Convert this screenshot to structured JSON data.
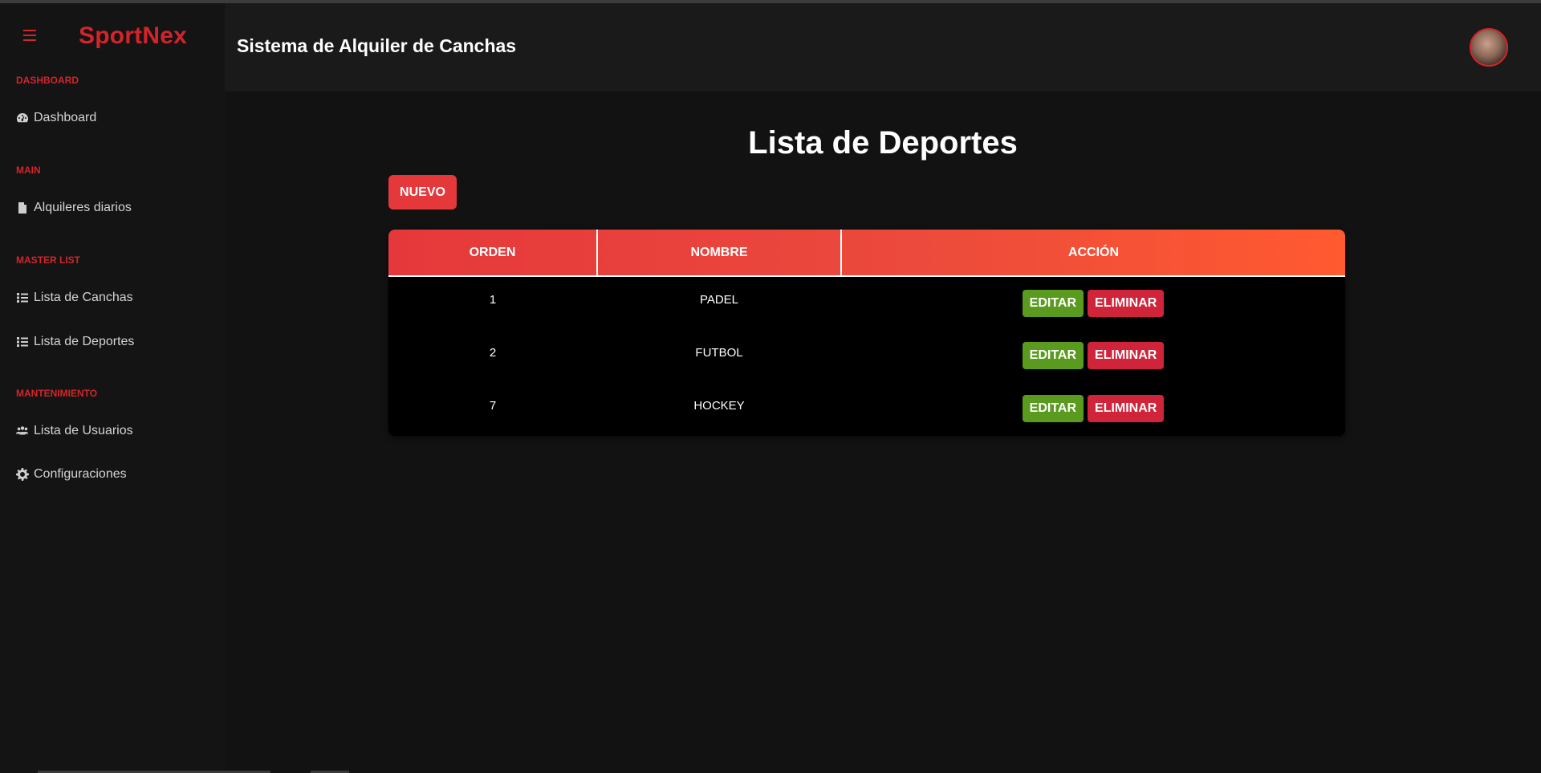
{
  "app": {
    "brand": "SportNex",
    "header_title": "Sistema de Alquiler de Canchas"
  },
  "sidebar": {
    "sections": [
      {
        "title": "DASHBOARD",
        "items": [
          {
            "label": "Dashboard",
            "icon": "gauge-icon"
          }
        ]
      },
      {
        "title": "MAIN",
        "items": [
          {
            "label": "Alquileres diarios",
            "icon": "file-icon"
          }
        ]
      },
      {
        "title": "MASTER LIST",
        "items": [
          {
            "label": "Lista de Canchas",
            "icon": "list-icon"
          },
          {
            "label": "Lista de Deportes",
            "icon": "list-icon"
          }
        ]
      },
      {
        "title": "MANTENIMIENTO",
        "items": [
          {
            "label": "Lista de Usuarios",
            "icon": "users-icon"
          },
          {
            "label": "Configuraciones",
            "icon": "gear-icon"
          }
        ]
      }
    ]
  },
  "main": {
    "title": "Lista de Deportes",
    "new_button": "NUEVO",
    "table": {
      "headers": [
        "ORDEN",
        "NOMBRE",
        "ACCIÓN"
      ],
      "rows": [
        {
          "orden": "1",
          "nombre": "PADEL"
        },
        {
          "orden": "2",
          "nombre": "FUTBOL"
        },
        {
          "orden": "7",
          "nombre": "HOCKEY"
        }
      ],
      "edit_label": "EDITAR",
      "delete_label": "ELIMINAR"
    }
  },
  "colors": {
    "accent": "#d3242a",
    "edit": "#5a9a1f",
    "delete": "#d0243b"
  }
}
